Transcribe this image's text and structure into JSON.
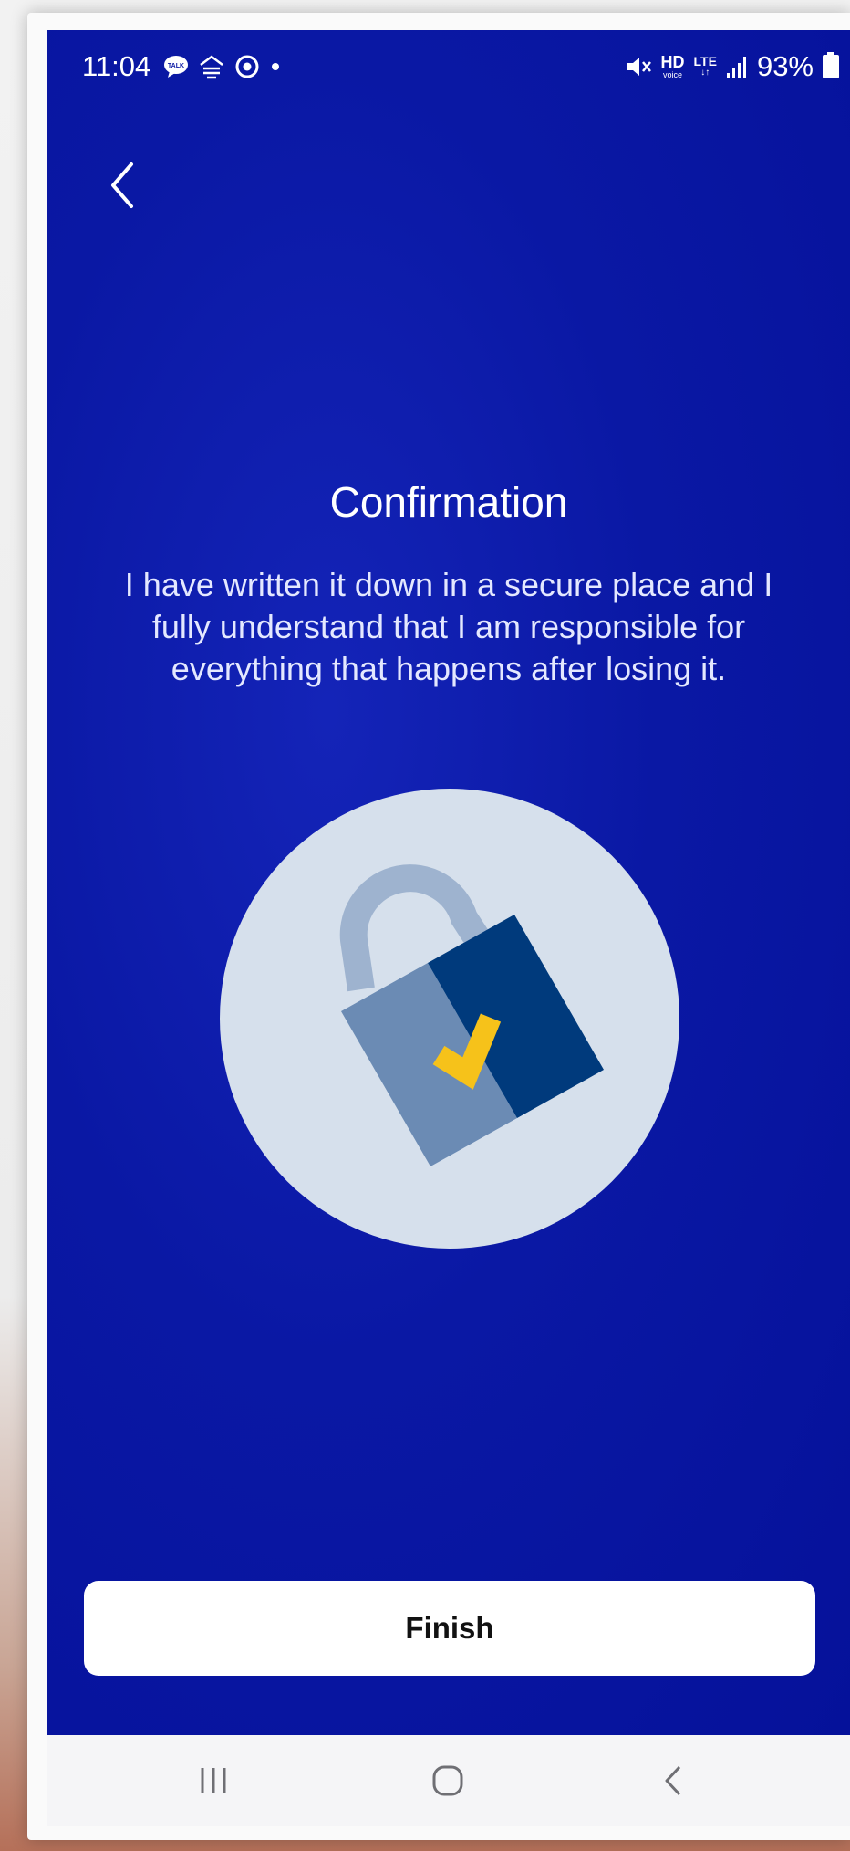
{
  "status_bar": {
    "time": "11:04",
    "left_icons": [
      "talk-icon",
      "chat-app-icon",
      "location-icon",
      "dot-icon"
    ],
    "right_icons": [
      "mute-icon",
      "hd-voice-icon",
      "lte-icon",
      "signal-icon",
      "battery-icon"
    ],
    "hd_label": "HD",
    "hd_sub": "voice",
    "lte_label": "LTE",
    "battery_percent": "93%"
  },
  "header": {
    "back_icon": "chevron-left-icon"
  },
  "content": {
    "title": "Confirmation",
    "message": "I have written it down in a secure place and I fully understand that I am responsible for everything that happens after losing it.",
    "illustration_icon": "padlock-check-icon"
  },
  "footer": {
    "finish_label": "Finish"
  },
  "nav_bar": {
    "items": [
      "recents-icon",
      "home-icon",
      "back-icon"
    ]
  },
  "colors": {
    "background": "#0a18a4",
    "button_bg": "#ffffff",
    "circle": "#d6e0ec",
    "lock_light": "#6b8bb4",
    "lock_dark": "#003a7c",
    "shackle": "#9eb3cf",
    "check": "#f6c21a"
  }
}
